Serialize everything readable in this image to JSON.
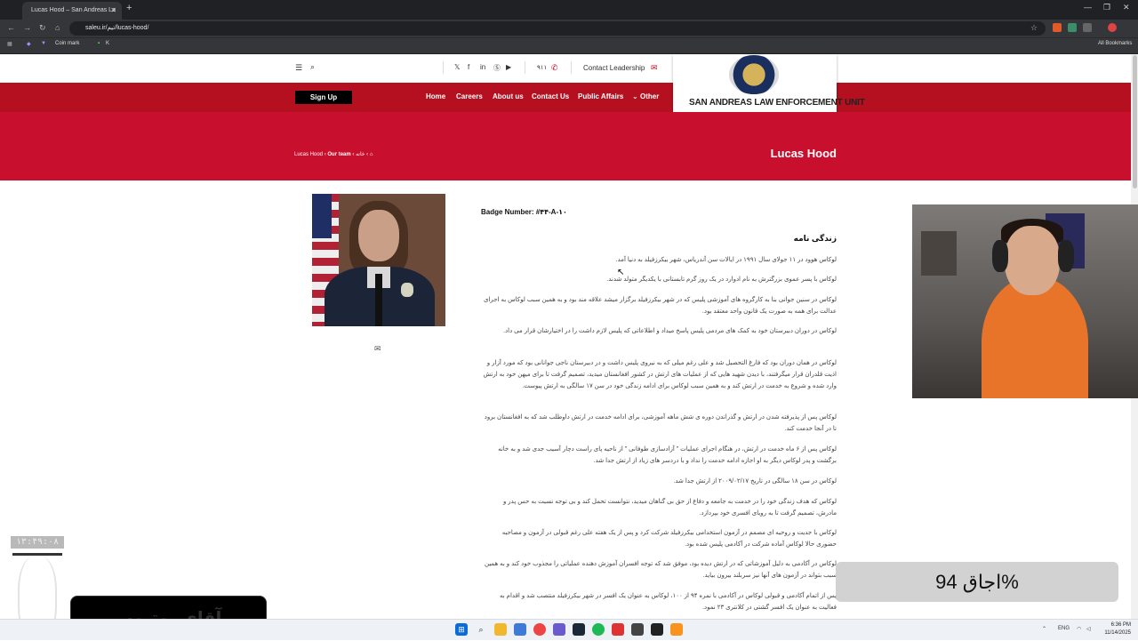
{
  "browser": {
    "tab_title": "Lucas Hood – San Andreas La",
    "tab_close": "✕",
    "new_tab": "+",
    "url": "saleu.ir/تیم/lucas-hood/",
    "bookmarks": [
      "Coin mark",
      "K"
    ],
    "all_bookmarks": "All Bookmarks",
    "window_controls": [
      "—",
      "❐",
      "✕"
    ]
  },
  "site": {
    "contact_leadership": "Contact Leadership",
    "phone": "۹۱۱",
    "logo_text": "SAN ANDREAS LAW ENFORCEMENT UNIT",
    "signup": "Sign Up",
    "nav": [
      "Home",
      "Careers",
      "About us",
      "Contact Us",
      "Public Affairs",
      "Other"
    ],
    "breadcrumb": {
      "name": "Lucas Hood",
      "team": "Our team",
      "home": "خانه"
    },
    "page_title": "Lucas Hood"
  },
  "profile": {
    "badge_number": "Badge Number: #۴۴-A-۱۰",
    "section_title": "زندگی نامه",
    "paragraphs": [
      "لوکاس هوود در ۱۱ جولای سال ۱۹۹۱ در ایالات سن آندریاس، شهر بیکرزفیلد به دنیا آمد.",
      "لوکاس با پسر عموی بزرگترش به نام ادوارد در یک روز گرم تابستانی با یکدیگر متولد شدند.",
      "لوکاس در سنین جوانی بنا به کارگروه های آموزشی پلیس که در شهر بیکرزفیلد برگزار میشد علاقه مند بود و به همین سبب لوکاس به اجرای عدالت برای همه به صورت یک قانون واحد معتقد بود.",
      "لوکاس در دوران دبیرستان خود به کمک های مردمی پلیس پاسخ میداد و اطلاعاتی که پلیس لازم داشت را در اختیارشان قرار می داد.",
      "لوکاس در همان دوران بود که فارغ التحصیل شد و علی رغم میلی که به نیروی پلیس داشت و در دبیرستان ناجی جوانانی بود که مورد آزار و اذیت قلدران قرار میگرفتند، با دیدن شهید هایی که از عملیات های ارتش در کشور افغانستان میدید، تصمیم گرفت تا برای میهن خود به ارتش وارد شده و شروع به خدمت در ارتش کند و به همین سبب لوکاس برای ادامه زندگی خود در سن ۱۷ سالگی به ارتش پیوست.",
      "لوکاس پس از پذیرفته شدن در ارتش و گذراندن دوره ی شش ماهه آموزشی، برای ادامه خدمت در ارتش داوطلب شد که به افغانستان برود تا در آنجا خدمت کند.",
      "لوکاس پس از ۶ ماه خدمت در ارتش، در هنگام اجرای عملیات \" آزادسازی طوفانی \" از ناحیه پای راست دچار آسیب جدی شد و به خانه برگشت و پدر لوکاس دیگر به او اجازه ادامه خدمت را نداد و با دردسر های زیاد از ارتش جدا شد.",
      "لوکاس در سن ۱۸ سالگی در تاریخ ۲۰۰۹/۰۲/۱۷ از ارتش جدا شد.",
      "لوکاس که هدف زندگی خود را در خدمت به جامعه و دفاع از حق بی گناهان میدید، نتوانست تحمل کند و بی توجه نسبت به حس پدر و مادرش، تصمیم گرفت تا به رویای افسری خود بپردازد.",
      "لوکاس با جدیت و روحیه ای مصمم در آزمون استخدامی بیکرزفیلد شرکت کرد و پس از یک هفته علی رغم قبولی در آزمون و مصاحبه حضوری حالا لوکاس آماده شرکت در آکادمی پلیس شده بود.",
      "لوکاس در آکادمی به دلیل آموزشاتی که در ارتش دیده بود، موفق شد که توجه افسران آموزش دهنده عملیاتی را مجذوب خود کند و به همین سبب بتواند در آزمون های آنها نیز سربلند بیرون بیاید.",
      "پس از اتمام آکادمی و قبولی لوکاس در آکادمی با نمره ۹۴ از ۱۰۰، لوکاس به عنوان یک افسر در شهر بیکرزفیلد منتصب شد و اقدام به فعالیت به عنوان یک افسر گشتی در کلانتری ۲۳ نمود."
    ]
  },
  "overlays": {
    "percent_label": "اجاق 94%",
    "timer": "۱۳:۴۹:۰۸",
    "black_box_text": "آقای یوتیوب"
  },
  "taskbar": {
    "lang": "ENG",
    "time": "6:36 PM",
    "date": "11/14/2025"
  },
  "colors": {
    "brand_red": "#c8102e",
    "dark_red": "#b5101f",
    "chrome_dark": "#202124"
  },
  "icons": [
    "menu-icon",
    "search-icon",
    "x-icon",
    "facebook-icon",
    "linkedin-icon",
    "skype-icon",
    "youtube-icon",
    "phone-icon",
    "mail-icon",
    "home-icon"
  ]
}
